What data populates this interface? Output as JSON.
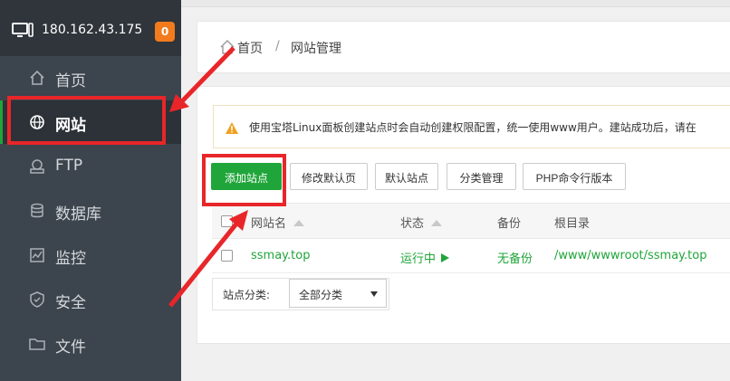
{
  "server": {
    "ip": "180.162.43.175",
    "badge": "0"
  },
  "sidebar": {
    "items": [
      {
        "label": "首页",
        "icon": "home-icon"
      },
      {
        "label": "网站",
        "icon": "globe-icon",
        "active": true
      },
      {
        "label": "FTP",
        "icon": "ftp-icon"
      },
      {
        "label": "数据库",
        "icon": "database-icon"
      },
      {
        "label": "监控",
        "icon": "monitor-icon"
      },
      {
        "label": "安全",
        "icon": "shield-icon"
      },
      {
        "label": "文件",
        "icon": "folder-icon"
      }
    ]
  },
  "breadcrumb": {
    "home": "首页",
    "separator": "/",
    "current": "网站管理"
  },
  "notice": {
    "text": "使用宝塔Linux面板创建站点时会自动创建权限配置，统一使用www用户。建站成功后，请在"
  },
  "toolbar": {
    "add_site": "添加站点",
    "edit_default_page": "修改默认页",
    "default_site": "默认站点",
    "category_manage": "分类管理",
    "php_cli_version": "PHP命令行版本"
  },
  "table": {
    "headers": {
      "name": "网站名",
      "status": "状态",
      "backup": "备份",
      "root": "根目录"
    },
    "rows": [
      {
        "name": "ssmay.top",
        "status": "运行中",
        "backup": "无备份",
        "root": "/www/wwwroot/ssmay.top"
      }
    ]
  },
  "filter": {
    "label": "站点分类:",
    "selected": "全部分类"
  },
  "colors": {
    "accent": "#20a53a",
    "sidebar_bg": "#3c444d",
    "badge": "#f37b1d",
    "annotation": "#e8262a"
  }
}
